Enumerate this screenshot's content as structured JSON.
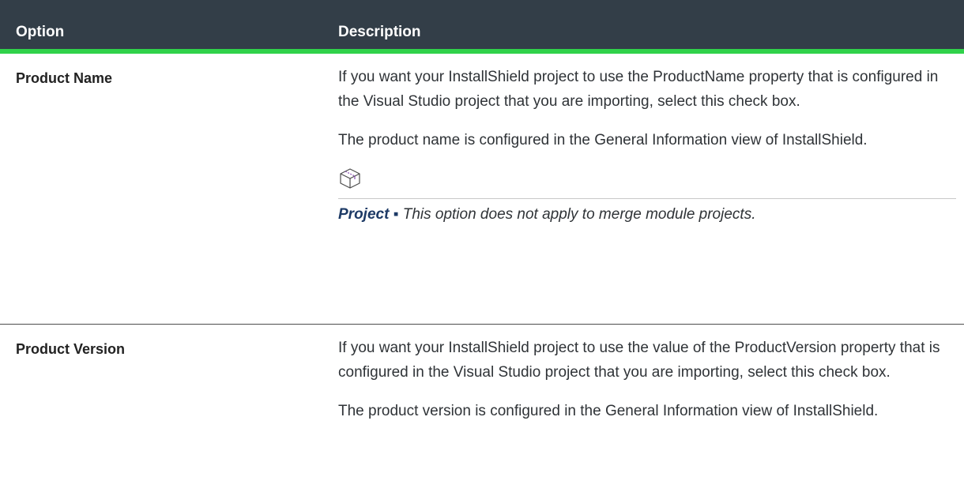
{
  "table": {
    "header": {
      "option": "Option",
      "description": "Description"
    },
    "rows": [
      {
        "option": "Product Name",
        "paragraphs": [
          "If you want your InstallShield project to use the ProductName property that is configured in the Visual Studio project that you are importing, select this check box.",
          "The product name is configured in the General Information view of InstallShield."
        ],
        "note": {
          "icon": "project-box-icon",
          "label": "Project ▪",
          "text": " This option does not apply to merge module projects."
        }
      },
      {
        "option": "Product Version",
        "paragraphs": [
          "If you want your InstallShield project to use the value of the ProductVersion property that is configured in the Visual Studio project that you are importing, select this check box.",
          "The product version is configured in the General Information view of InstallShield."
        ]
      }
    ]
  },
  "colors": {
    "header_bg": "#333e48",
    "accent_bar": "#30d24a",
    "note_label": "#1d3a66"
  }
}
